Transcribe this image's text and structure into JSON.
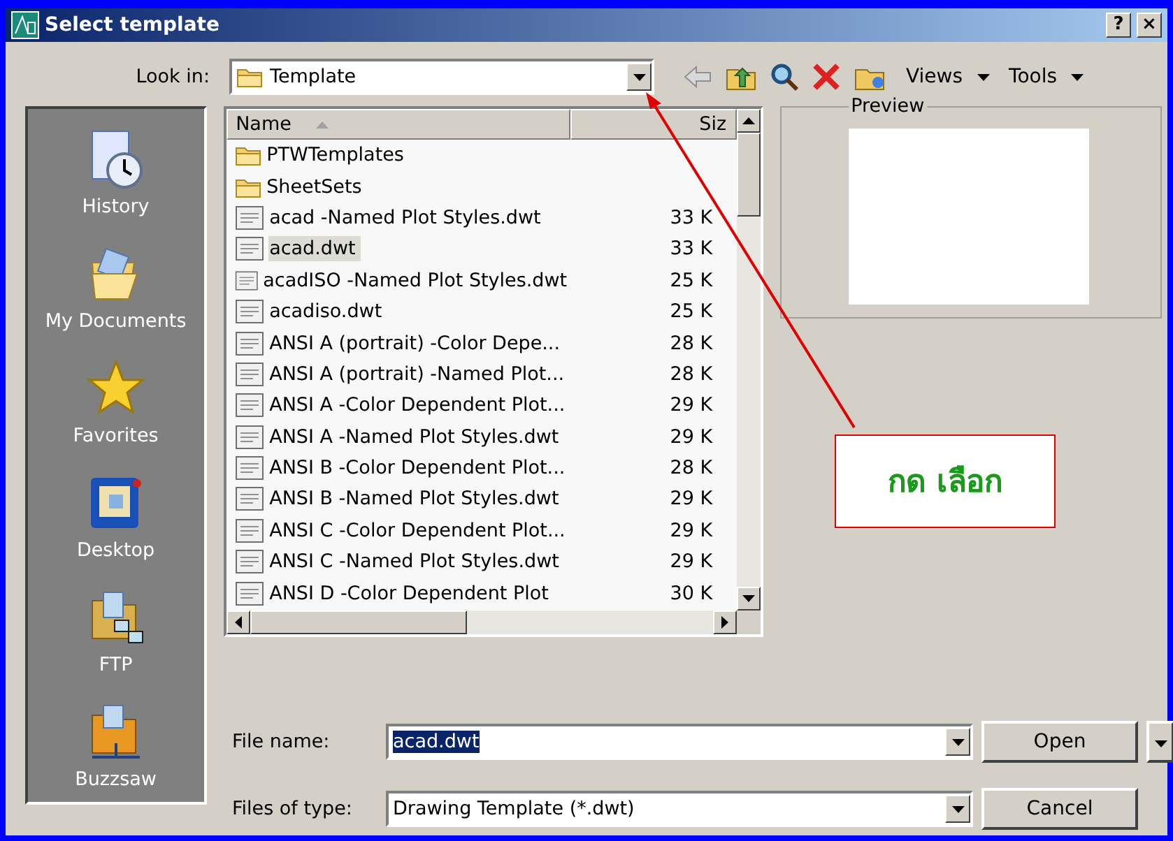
{
  "window": {
    "title": "Select template"
  },
  "look_in": {
    "label": "Look in:",
    "value": "Template"
  },
  "toolbar": {
    "views": "Views",
    "tools": "Tools"
  },
  "places": [
    {
      "label": "History",
      "kind": "history"
    },
    {
      "label": "My Documents",
      "kind": "documents"
    },
    {
      "label": "Favorites",
      "kind": "favorites"
    },
    {
      "label": "Desktop",
      "kind": "desktop"
    },
    {
      "label": "FTP",
      "kind": "ftp"
    },
    {
      "label": "Buzzsaw",
      "kind": "buzzsaw"
    }
  ],
  "file_list": {
    "columns": [
      "Name",
      "Siz"
    ],
    "rows": [
      {
        "name": "PTWTemplates",
        "size": "",
        "kind": "folder",
        "selected": false
      },
      {
        "name": "SheetSets",
        "size": "",
        "kind": "folder",
        "selected": false
      },
      {
        "name": "acad -Named Plot Styles.dwt",
        "size": "33 K",
        "kind": "file",
        "selected": false
      },
      {
        "name": "acad.dwt",
        "size": "33 K",
        "kind": "file",
        "selected": true
      },
      {
        "name": "acadISO -Named Plot Styles.dwt",
        "size": "25 K",
        "kind": "file",
        "selected": false
      },
      {
        "name": "acadiso.dwt",
        "size": "25 K",
        "kind": "file",
        "selected": false
      },
      {
        "name": "ANSI A (portrait) -Color Depe...",
        "size": "28 K",
        "kind": "file",
        "selected": false
      },
      {
        "name": "ANSI A (portrait) -Named Plot...",
        "size": "28 K",
        "kind": "file",
        "selected": false
      },
      {
        "name": "ANSI A -Color Dependent Plot...",
        "size": "29 K",
        "kind": "file",
        "selected": false
      },
      {
        "name": "ANSI A -Named Plot Styles.dwt",
        "size": "29 K",
        "kind": "file",
        "selected": false
      },
      {
        "name": "ANSI B -Color Dependent Plot...",
        "size": "28 K",
        "kind": "file",
        "selected": false
      },
      {
        "name": "ANSI B -Named Plot Styles.dwt",
        "size": "29 K",
        "kind": "file",
        "selected": false
      },
      {
        "name": "ANSI C -Color Dependent Plot...",
        "size": "29 K",
        "kind": "file",
        "selected": false
      },
      {
        "name": "ANSI C -Named Plot Styles.dwt",
        "size": "29 K",
        "kind": "file",
        "selected": false
      },
      {
        "name": "ANSI D -Color Dependent Plot",
        "size": "30 K",
        "kind": "file",
        "selected": false
      }
    ]
  },
  "preview": {
    "label": "Preview"
  },
  "file_name": {
    "label": "File name:",
    "value": "acad.dwt"
  },
  "file_type": {
    "label": "Files of type:",
    "value": "Drawing Template (*.dwt)"
  },
  "buttons": {
    "open": "Open",
    "cancel": "Cancel",
    "help": "?",
    "close": "×"
  },
  "annotation": {
    "text": "กด เลือก"
  }
}
